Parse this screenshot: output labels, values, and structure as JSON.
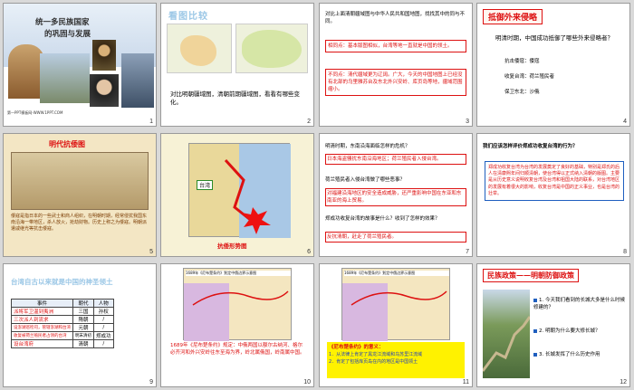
{
  "slides": [
    {
      "num": "1",
      "title_line1": "统一多民族国家",
      "title_line2": "的巩固与发展",
      "footer": "第一PPT模板网-WWW.1PPT.COM"
    },
    {
      "num": "2",
      "title": "看图比较",
      "caption": "对比明朝疆域图，清朝前期疆域图，看看有哪些变化。"
    },
    {
      "num": "3",
      "intro": "对比上面清朝疆域图与中华人民共和国地图，找找其中的同与不同。",
      "same": "相同点：基本版图相似，台湾等地一直就是中国的领土。",
      "diff": "不同点：清代疆域更为辽阔。广大，今天的中国地图上已经没有北部的乌里雅苏台及东北外兴安岭、库页岛等地，疆域范围缩小。"
    },
    {
      "num": "4",
      "header": "抵御外来侵略",
      "question": "明清时期，中国成功抵御了哪些外来侵略者？",
      "row1": "抗击倭寇：倭寇",
      "row2": "收复台湾：荷兰殖民者",
      "row3": "保卫东北：沙俄"
    },
    {
      "num": "5",
      "title": "明代抗倭图",
      "body": "倭寇是指日本的一些武士和商人组织，在明朝时期，经常侵扰我国东南沿海一带地区，杀人放火，抢劫财物。历史上称之为倭寇。明朝派遣戚继光等抗击倭寇。"
    },
    {
      "num": "6",
      "label": "台湾",
      "caption": "抗倭形势图"
    },
    {
      "num": "7",
      "q1": "明清时期，东南沿海面临怎样的危机？",
      "a1": "日本海盗骚扰东南沿海地区；荷兰殖民者入侵台湾。",
      "q2": "荷兰殖民者入侵台湾做了哪些恶事？",
      "a2": "对福建沿海地区的安全造成威胁，还严重影响中国在东亚和东南亚的海上贸易。",
      "q3": "郑成功收复台湾的故事是什么？收到了怎样的效果？",
      "a3": "反抗清朝，赶走了荷兰殖民者。"
    },
    {
      "num": "8",
      "question": "我们应该怎样评价郑成功收复台湾的行为？",
      "answer": "郑成功收复台湾为台湾的发展奠定了良好的基础，特别是郑氏的后人在清康熙年间归顺清朝，使台湾得以正式纳入清朝的版图。主要是从历史意义说明收复台湾及台湾和祖国大陆的联系，对台湾地区的发展有着很大的影响，收复台湾是中国的正义事业，也是台湾的壮举。"
    },
    {
      "num": "9",
      "title": "台湾自古以来就是中国的神圣领土",
      "headers": [
        "事件",
        "朝代",
        "人物"
      ],
      "rows": [
        [
          "派将军卫温到夷洲",
          "三国",
          "孙权"
        ],
        [
          "三次派人到流求",
          "隋朝",
          "/"
        ],
        [
          "设澎湖巡检司，管辖澎湖和台湾",
          "元朝",
          "/"
        ],
        [
          "收复被荷兰殖民者占领的台湾",
          "明末清初",
          "郑成功"
        ],
        [
          "设台湾府",
          "清朝",
          "/"
        ]
      ]
    },
    {
      "num": "10",
      "map_title": "1689年《尼布楚条约》划定中俄边界示意图",
      "caption": "1689年《尼布楚条约》规定：中俄两国以额尔古纳河、格尔必齐河和外兴安岭往东至海为界，岭北属俄国，岭南属中国。"
    },
    {
      "num": "11",
      "map_title": "1689年《尼布楚条约》划定中俄边界示意图",
      "note_title": "《尼布楚条约》的意义：",
      "note1": "1．从法律上肯定了黑龙江流域和乌苏里江流域",
      "note2": "2．肯定了包括库页岛在内的地区是中国领土"
    },
    {
      "num": "12",
      "title": "民族政策——明朝防御政策",
      "q1": "1. 今天我们看到的长城大多是什么时候修建的？",
      "q2": "2. 明朝为什么要大修长城？",
      "q3": "3. 长城发挥了什么历史作用"
    }
  ],
  "colors": {
    "selection": "#e6a300",
    "red": "#dd1111",
    "blue": "#1f5fbf"
  }
}
